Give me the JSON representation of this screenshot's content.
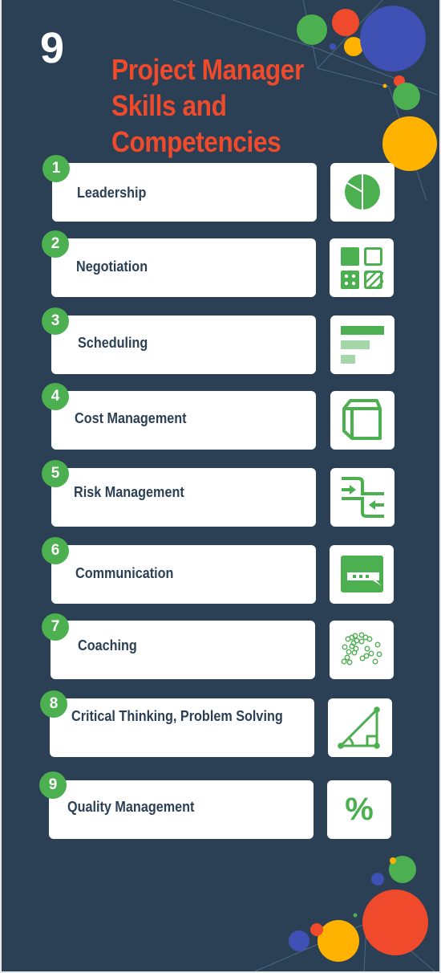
{
  "header": {
    "number": "9",
    "title_lines": [
      "Project Manager",
      "Skills and",
      "Competencies"
    ]
  },
  "colors": {
    "background": "#2b3f55",
    "title": "#ef4a2b",
    "accent_green": "#4caf50",
    "light_green": "#a5d6a7",
    "card_text": "#2b3f55",
    "dot_blue": "#3f51b5",
    "dot_yellow": "#ffb300",
    "dot_red": "#ef4a2b"
  },
  "skills": [
    {
      "number": "1",
      "label": "Leadership",
      "icon": "pie-chart-icon"
    },
    {
      "number": "2",
      "label": "Negotiation",
      "icon": "grid-squares-icon"
    },
    {
      "number": "3",
      "label": "Scheduling",
      "icon": "bar-chart-icon"
    },
    {
      "number": "4",
      "label": "Cost Management",
      "icon": "cube-icon"
    },
    {
      "number": "5",
      "label": "Risk Management",
      "icon": "merge-arrows-icon"
    },
    {
      "number": "6",
      "label": "Communication",
      "icon": "chat-bubble-icon"
    },
    {
      "number": "7",
      "label": "Coaching",
      "icon": "scatter-circles-icon"
    },
    {
      "number": "8",
      "label": "Critical Thinking, Problem Solving",
      "icon": "triangle-icon"
    },
    {
      "number": "9",
      "label": "Quality Management",
      "icon": "percent-icon"
    }
  ],
  "percent_glyph": "%"
}
